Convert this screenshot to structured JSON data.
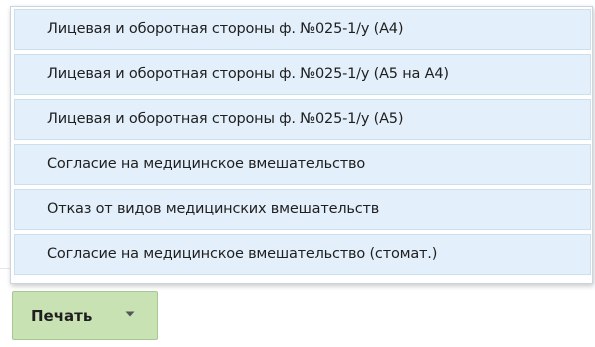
{
  "print_menu": {
    "items": [
      {
        "label": "Лицевая и оборотная стороны ф. №025-1/у (А4)"
      },
      {
        "label": "Лицевая и оборотная стороны ф. №025-1/у (А5 на А4)"
      },
      {
        "label": "Лицевая и оборотная стороны ф. №025-1/у (А5)"
      },
      {
        "label": "Согласие на медицинское вмешательство"
      },
      {
        "label": "Отказ от видов медицинских вмешательств"
      },
      {
        "label": "Согласие на медицинское вмешательство (стомат.)"
      }
    ]
  },
  "print_button": {
    "label": "Печать",
    "icon": "chevron-down-icon"
  },
  "colors": {
    "menu_item_bg": "#e3f0fb",
    "menu_item_border": "#ccdfee",
    "button_bg": "#c8e2b3",
    "button_border": "#a9c795",
    "text": "#1f1f1f"
  }
}
